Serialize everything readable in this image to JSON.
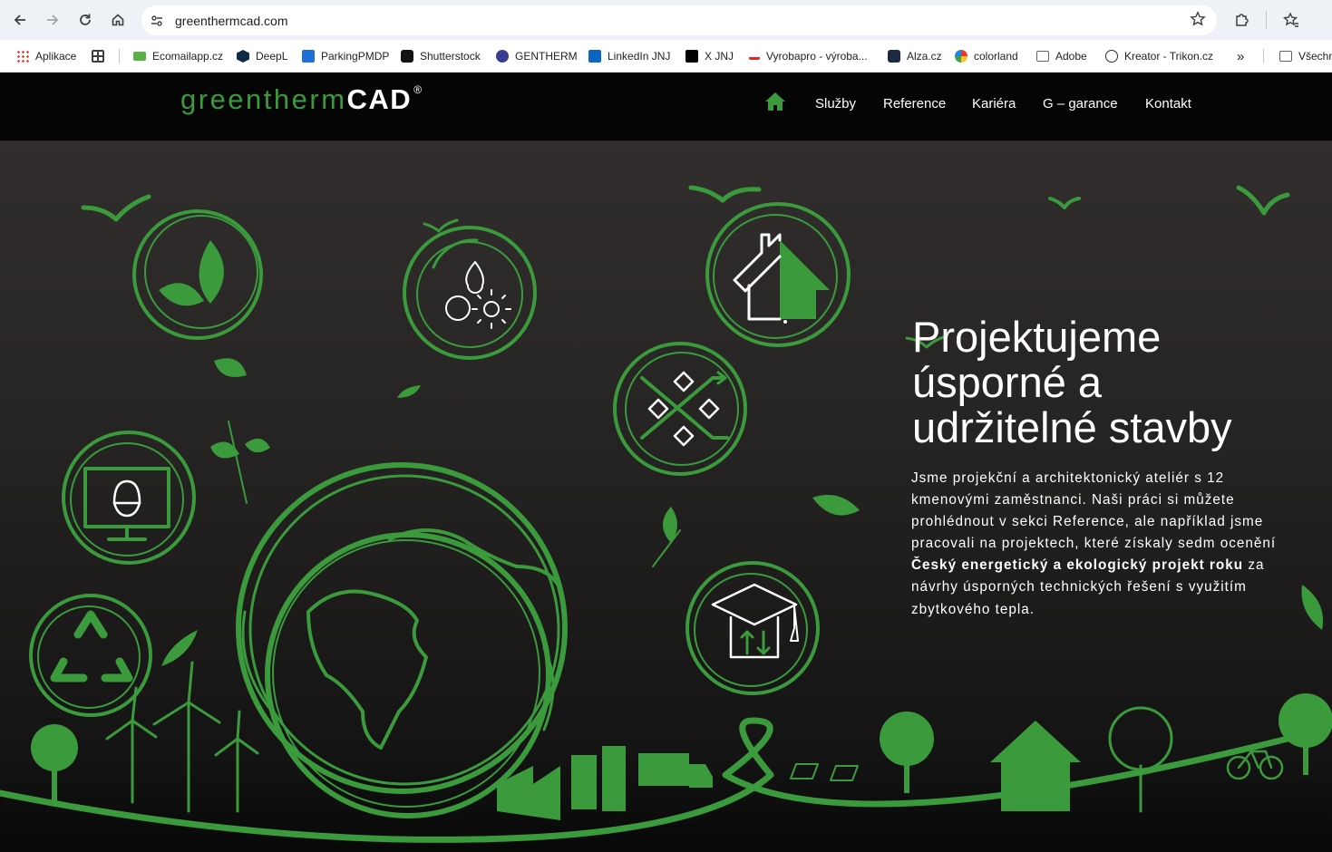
{
  "browser": {
    "url": "greenthermcad.com",
    "bookmarks": [
      {
        "label": "Aplikace",
        "color": "#4285f4"
      },
      {
        "label": "",
        "color": "#3c4043"
      },
      {
        "label": "Ecomailapp.cz",
        "color": "#58b046"
      },
      {
        "label": "DeepL",
        "color": "#0f2b46"
      },
      {
        "label": "ParkingPMDP",
        "color": "#1f6fd8"
      },
      {
        "label": "Shutterstock",
        "color": "#111111"
      },
      {
        "label": "GENTHERM",
        "color": "#3a3d8f"
      },
      {
        "label": "LinkedIn JNJ",
        "color": "#0a66c2"
      },
      {
        "label": "X JNJ",
        "color": "#000000"
      },
      {
        "label": "Vyrobapro - výroba...",
        "color": "#e1251b"
      },
      {
        "label": "Alza.cz",
        "color": "#1d2a44"
      },
      {
        "label": "colorland",
        "color": "#e53935"
      },
      {
        "label": "Adobe",
        "color": "#5f6368"
      },
      {
        "label": "Kreator - Trikon.cz",
        "color": "#2b2b2b"
      }
    ],
    "overflow": "»",
    "all_bookmarks": "Všechny záložky"
  },
  "site": {
    "logo": {
      "green": "greentherm",
      "white": "CAD",
      "mark": "®"
    },
    "nav": [
      "Služby",
      "Reference",
      "Kariéra",
      "G – garance",
      "Kontakt"
    ],
    "colors": {
      "accent": "#3a9a3c",
      "background": "#262423"
    }
  },
  "hero": {
    "title_lines": [
      "Projektujeme",
      "úsporné a",
      "udržitelné stavby"
    ],
    "text_before": "Jsme projekční a architektonický ateliér s 12 kmenovými zaměstnanci. Naši práci si můžete prohlédnout v sekci Reference, ale například jsme pracovali na projektech, které získaly sedm ocenění ",
    "text_bold": "Český energetický a ekologický projekt roku",
    "text_after": " za návrhy úsporných technických řešení s využitím zbytkového tepla."
  }
}
